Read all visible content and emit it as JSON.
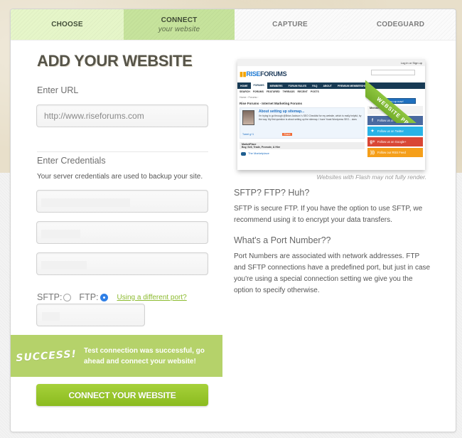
{
  "steps": [
    {
      "label": "CHOOSE",
      "sub": ""
    },
    {
      "label": "CONNECT",
      "sub": "your website"
    },
    {
      "label": "CAPTURE",
      "sub": ""
    },
    {
      "label": "CODEGUARD",
      "sub": ""
    }
  ],
  "active_step": "CONNECT",
  "form": {
    "title": "ADD YOUR WEBSITE",
    "url_label": "Enter URL",
    "url_placeholder": "http://www.riseforums.com",
    "url_value": "",
    "credentials_label": "Enter Credentials",
    "credentials_help": "Your server credentials are used to backup your site.",
    "host_value": "",
    "username_value": "",
    "password_value": "",
    "protocol_options": [
      {
        "label": "SFTP:",
        "checked": false
      },
      {
        "label": "FTP:",
        "checked": true
      }
    ],
    "port_link": "Using a different port?",
    "port_value": ""
  },
  "success": {
    "badge": "SUCCESS!",
    "message": "Test connection was successful, go ahead and connect your website!"
  },
  "connect_button": "CONNECT YOUR WEBSITE",
  "preview": {
    "ribbon": "WEBSITE PREVIEW",
    "note": "Websites with Flash may not fully render.",
    "site": {
      "top_link": "Log in or Sign up",
      "logo_rise": "RISE",
      "logo_forums": "FORUMS",
      "nav": [
        "HOME",
        "FORUMS",
        "MEMBERS",
        "FORUM RULES",
        "FAQ",
        "ABOUT",
        "PREMIUM MEMBERSHIP"
      ],
      "subnav": "SEARCH FORUMS  FEATURED THREADS  RECENT POSTS",
      "breadcrumb": "Home › Forums ›",
      "page_title": "Rise Forums - Internet Marketing Forums",
      "thread_title": "About setting up sitemap...",
      "thread_body": "I'm trying to go through @Brian Jackson 's SEO Checklist for my website, which is really helpful, by the way. My first question is about setting up the sitemap. I have Yoast Wordpress SEO... does",
      "share": "Tweet  g+1",
      "share_btn": "Share",
      "market_title": "MarketPlace",
      "market_sub": "Buy, Sell, Trade, Promote, & Hire",
      "market_item": "The Marketplace",
      "signup": "Sign up now!",
      "members_online": "Members Online Now",
      "follow": [
        {
          "icon": "f",
          "label": "Follow us on Facebook"
        },
        {
          "icon": "t",
          "label": "Follow us on Twitter"
        },
        {
          "icon": "g+",
          "label": "Follow us on Google+"
        },
        {
          "icon": "rss",
          "label": "Follow our RSS Feed"
        }
      ]
    }
  },
  "info": {
    "sftp_heading": "SFTP? FTP? Huh?",
    "sftp_text": "SFTP is secure FTP. If you have the option to use SFTP, we recommend using it to encrypt your data transfers.",
    "port_heading": "What's a Port Number??",
    "port_text": "Port Numbers are associated with network addresses. FTP and SFTP connections have a predefined port, but just in case you're using a special connection setting we give you the option to specify otherwise."
  }
}
